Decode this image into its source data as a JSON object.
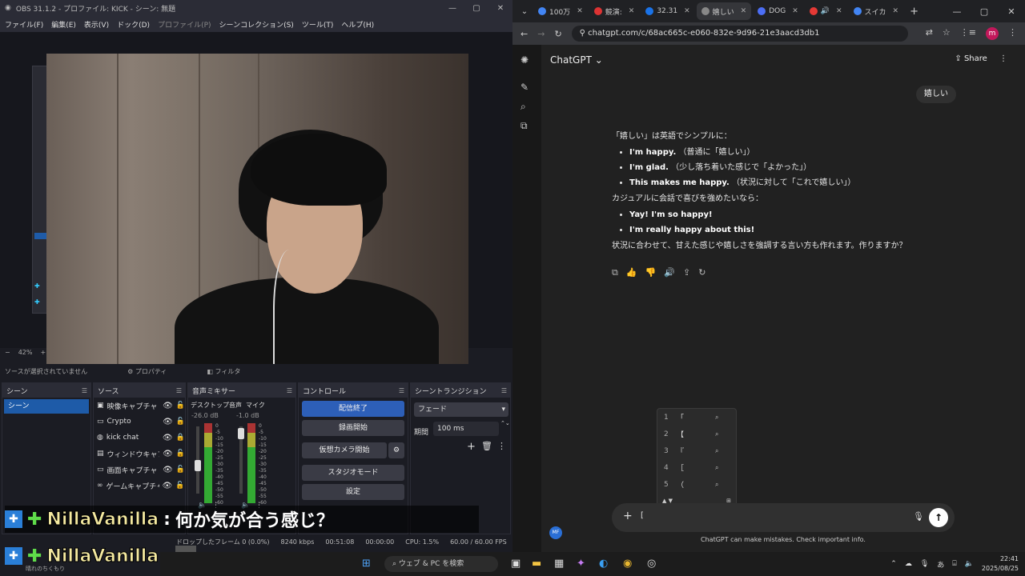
{
  "obs": {
    "title": "OBS 31.1.2 - プロファイル: KICK - シーン: 無題",
    "menu": [
      "ファイル(F)",
      "編集(E)",
      "表示(V)",
      "ドック(D)",
      "プロファイル(P)",
      "シーンコレクション(S)",
      "ツール(T)",
      "ヘルプ(H)"
    ],
    "zoom": "42%",
    "no_source": "ソースが選択されていません",
    "props_label": "プロパティ",
    "filters_label": "フィルタ",
    "docks": {
      "scenes": {
        "title": "シーン",
        "items": [
          "シーン"
        ]
      },
      "sources": {
        "title": "ソース",
        "items": [
          "映像キャプチャ",
          "Crypto",
          "kick chat",
          "ウィンドウキャプ",
          "画面キャプチャ",
          "ゲームキャプチャ"
        ]
      },
      "mixer": {
        "title": "音声ミキサー",
        "ch1": "デスクトップ音声",
        "ch1_db": "-26.0 dB",
        "ch2": "マイク",
        "ch2_db": "-1.0 dB",
        "ticks": [
          "0",
          "-5",
          "-10",
          "-15",
          "-20",
          "-25",
          "-30",
          "-35",
          "-40",
          "-45",
          "-50",
          "-55",
          "-60"
        ]
      },
      "controls": {
        "title": "コントロール",
        "buttons": [
          "配信終了",
          "録画開始",
          "仮想カメラ開始",
          "スタジオモード",
          "設定"
        ]
      },
      "transitions": {
        "title": "シーントランジション",
        "type": "フェード",
        "duration_label": "期間",
        "duration": "100 ms"
      }
    },
    "status": {
      "dropped": "ドロップしたフレーム 0 (0.0%)",
      "kbps": "8240 kbps",
      "live": "00:51:08",
      "rec": "00:00:00",
      "cpu": "CPU: 1.5%",
      "fps": "60.00 / 60.00 FPS"
    }
  },
  "chat": [
    {
      "name": "NillaVanilla",
      "sep": ":",
      "msg": "何か気が合う感じ？"
    },
    {
      "name": "NillaVanilla",
      "sep": ":",
      "msg": "",
      "sub": "晴れのちくもり"
    }
  ],
  "chrome": {
    "tabs": [
      {
        "label": "100万",
        "color": "#4285f4"
      },
      {
        "label": "競演:",
        "color": "#d33"
      },
      {
        "label": "32.31",
        "color": "#1a73e8"
      },
      {
        "label": "嬉しい",
        "color": "#888"
      },
      {
        "label": "DOG",
        "color": "#4c6ef5"
      },
      {
        "label": "",
        "color": "#e53935"
      },
      {
        "label": "スイカ",
        "color": "#4285f4"
      }
    ],
    "url": "chatgpt.com/c/68ac665c-e060-832e-9d96-21e3aacd3db1"
  },
  "gpt": {
    "brand": "ChatGPT",
    "share": "Share",
    "user_msg": "嬉しい",
    "intro": "「嬉しい」は英語でシンプルに：",
    "list1": [
      {
        "b": "I'm happy.",
        "t": "（普通に「嬉しい」）"
      },
      {
        "b": "I'm glad.",
        "t": "（少し落ち着いた感じで「よかった」）"
      },
      {
        "b": "This makes me happy.",
        "t": "（状況に対して「これで嬉しい」）"
      }
    ],
    "mid": "カジュアルに会話で喜びを強めたいなら：",
    "list2": [
      "Yay! I'm so happy!",
      "I'm really happy about this!"
    ],
    "outro": "状況に合わせて、甘えた感じや嬉しさを強調する言い方も作れます。作りますか？",
    "ime": [
      {
        "n": "1",
        "c": "「"
      },
      {
        "n": "2",
        "c": "【"
      },
      {
        "n": "3",
        "c": "『"
      },
      {
        "n": "4",
        "c": "［"
      },
      {
        "n": "5",
        "c": "（"
      }
    ],
    "composer_text": "[",
    "disclaimer": "ChatGPT can make mistakes. Check important info.",
    "avatar": "MF"
  },
  "taskbar": {
    "search": "ウェブ & PC を検索",
    "ime": "あ",
    "time": "22:41",
    "date": "2025/08/25"
  }
}
